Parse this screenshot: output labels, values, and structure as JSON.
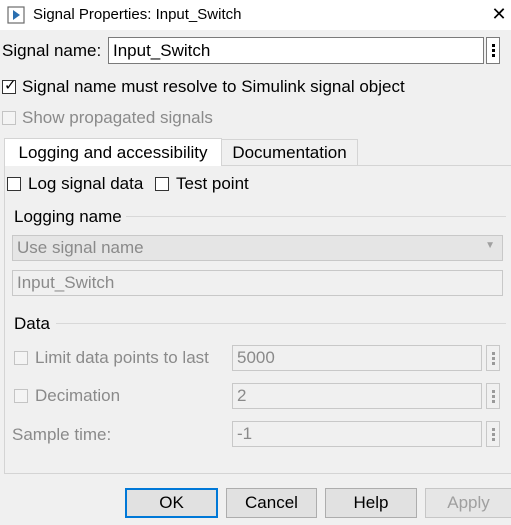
{
  "window": {
    "title": "Signal Properties: Input_Switch",
    "close_glyph": "✕"
  },
  "signal": {
    "name_label": "Signal name:",
    "name_value": "Input_Switch",
    "resolve_label": "Signal name must resolve to Simulink signal object",
    "resolve_checked": true,
    "propagated_label": "Show propagated signals",
    "propagated_checked": false
  },
  "tabs": [
    {
      "label": "Logging and accessibility",
      "active": true
    },
    {
      "label": "Documentation",
      "active": false
    }
  ],
  "logging": {
    "log_data_label": "Log signal data",
    "test_point_label": "Test point",
    "logging_name_header": "Logging name",
    "name_mode": "Use signal name",
    "name_value": "Input_Switch"
  },
  "data_section": {
    "header": "Data",
    "limit_label": "Limit data points to last",
    "limit_value": "5000",
    "decimation_label": "Decimation",
    "decimation_value": "2",
    "sample_time_label": "Sample time:",
    "sample_time_value": "-1"
  },
  "buttons": {
    "ok": "OK",
    "cancel": "Cancel",
    "help": "Help",
    "apply": "Apply"
  },
  "colors": {
    "focus_border": "#0078d7",
    "disabled_text": "#8a8a8a"
  }
}
